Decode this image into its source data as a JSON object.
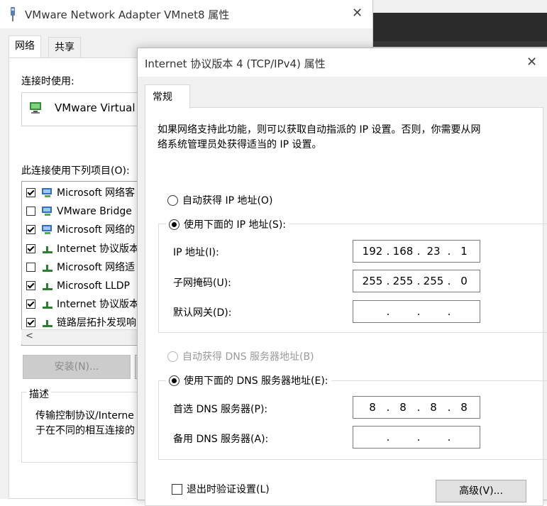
{
  "back_window": {
    "title": "VMware Network Adapter VMnet8 属性",
    "tabs": [
      "网络",
      "共享"
    ],
    "connect_using_label": "连接时使用:",
    "adapter_name": "VMware Virtual",
    "items_label": "此连接使用下列项目(O):",
    "items": [
      {
        "label": "Microsoft 网络客",
        "checked": true
      },
      {
        "label": "VMware Bridge",
        "checked": false
      },
      {
        "label": "Microsoft 网络的",
        "checked": true
      },
      {
        "label": "Internet 协议版本",
        "checked": true
      },
      {
        "label": "Microsoft 网络适",
        "checked": false
      },
      {
        "label": "Microsoft LLDP",
        "checked": true
      },
      {
        "label": "Internet 协议版本",
        "checked": true
      },
      {
        "label": "链路层拓扑发现响",
        "checked": true
      }
    ],
    "install_button": "安装(N)...",
    "description_title": "描述",
    "description_line1": "传输控制协议/Interne",
    "description_line2": "于在不同的相互连接的"
  },
  "front_window": {
    "title": "Internet 协议版本 4 (TCP/IPv4) 属性",
    "tab": "常规",
    "info_line1": "如果网络支持此功能，则可以获取自动指派的 IP 设置。否则，你需要从网",
    "info_line2": "络系统管理员处获得适当的 IP 设置。",
    "auto_ip_label": "自动获得 IP 地址(O)",
    "manual_ip_label": "使用下面的 IP 地址(S):",
    "ip_label": "IP 地址(I):",
    "ip": [
      "192",
      "168",
      "23",
      "1"
    ],
    "mask_label": "子网掩码(U):",
    "mask": [
      "255",
      "255",
      "255",
      "0"
    ],
    "gateway_label": "默认网关(D):",
    "gateway": [
      "",
      "",
      "",
      ""
    ],
    "auto_dns_label": "自动获得 DNS 服务器地址(B)",
    "manual_dns_label": "使用下面的 DNS 服务器地址(E):",
    "pref_dns_label": "首选 DNS 服务器(P):",
    "pref_dns": [
      "8",
      "8",
      "8",
      "8"
    ],
    "alt_dns_label": "备用 DNS 服务器(A):",
    "alt_dns": [
      "",
      "",
      "",
      ""
    ],
    "validate_label": "退出时验证设置(L)",
    "advanced_button": "高级(V)..."
  },
  "icons": [
    "network-adapter-icon",
    "close-icon",
    "network-component-icon",
    "protocol-icon"
  ]
}
